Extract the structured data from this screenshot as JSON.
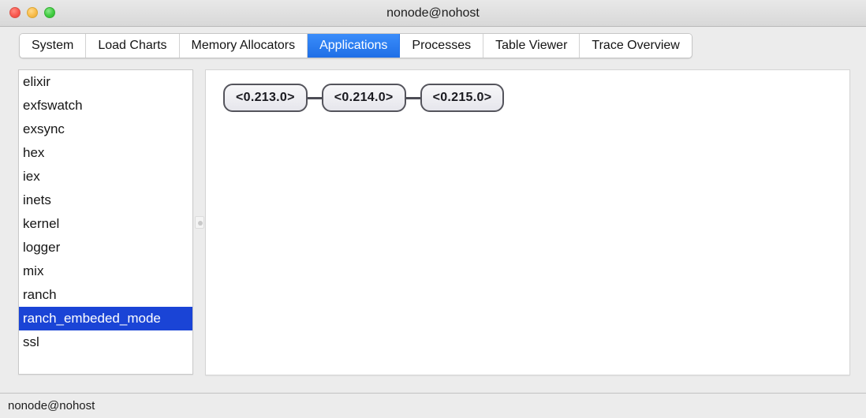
{
  "window": {
    "title": "nonode@nohost",
    "controls": [
      {
        "name": "close",
        "color": "#f9584f"
      },
      {
        "name": "minimize",
        "color": "#f9bc4a"
      },
      {
        "name": "maximize",
        "color": "#41cc41"
      }
    ]
  },
  "tabs": {
    "active_index": 3,
    "items": [
      {
        "label": "System"
      },
      {
        "label": "Load Charts"
      },
      {
        "label": "Memory Allocators"
      },
      {
        "label": "Applications"
      },
      {
        "label": "Processes"
      },
      {
        "label": "Table Viewer"
      },
      {
        "label": "Trace Overview"
      }
    ]
  },
  "sidebar": {
    "selected_index": 10,
    "items": [
      {
        "label": "elixir"
      },
      {
        "label": "exfswatch"
      },
      {
        "label": "exsync"
      },
      {
        "label": "hex"
      },
      {
        "label": "iex"
      },
      {
        "label": "inets"
      },
      {
        "label": "kernel"
      },
      {
        "label": "logger"
      },
      {
        "label": "mix"
      },
      {
        "label": "ranch"
      },
      {
        "label": "ranch_embeded_mode"
      },
      {
        "label": "ssl"
      }
    ]
  },
  "graph": {
    "nodes": [
      {
        "pid": "<0.213.0>"
      },
      {
        "pid": "<0.214.0>"
      },
      {
        "pid": "<0.215.0>"
      }
    ]
  },
  "statusbar": {
    "text": "nonode@nohost"
  },
  "colors": {
    "tab_active": "#2a7ff5",
    "selection": "#1a44d6",
    "node_border": "#54545c",
    "window_chrome": "#ececec"
  }
}
